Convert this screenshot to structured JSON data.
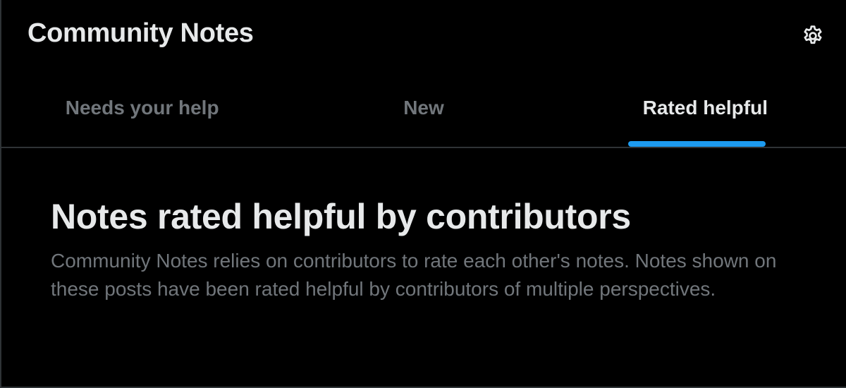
{
  "header": {
    "title": "Community Notes",
    "settings_icon": "gear-icon"
  },
  "tabs": [
    {
      "label": "Needs your help",
      "active": false
    },
    {
      "label": "New",
      "active": false
    },
    {
      "label": "Rated helpful",
      "active": true
    }
  ],
  "main": {
    "title": "Notes rated helpful by contributors",
    "description": "Community Notes relies on contributors to rate each other's notes. Notes shown on these posts have been rated helpful by contributors of multiple perspectives."
  },
  "colors": {
    "background": "#000000",
    "primary_text": "#e7e9ea",
    "secondary_text": "#71767b",
    "accent": "#1d9bf0",
    "divider": "#2f3336"
  }
}
